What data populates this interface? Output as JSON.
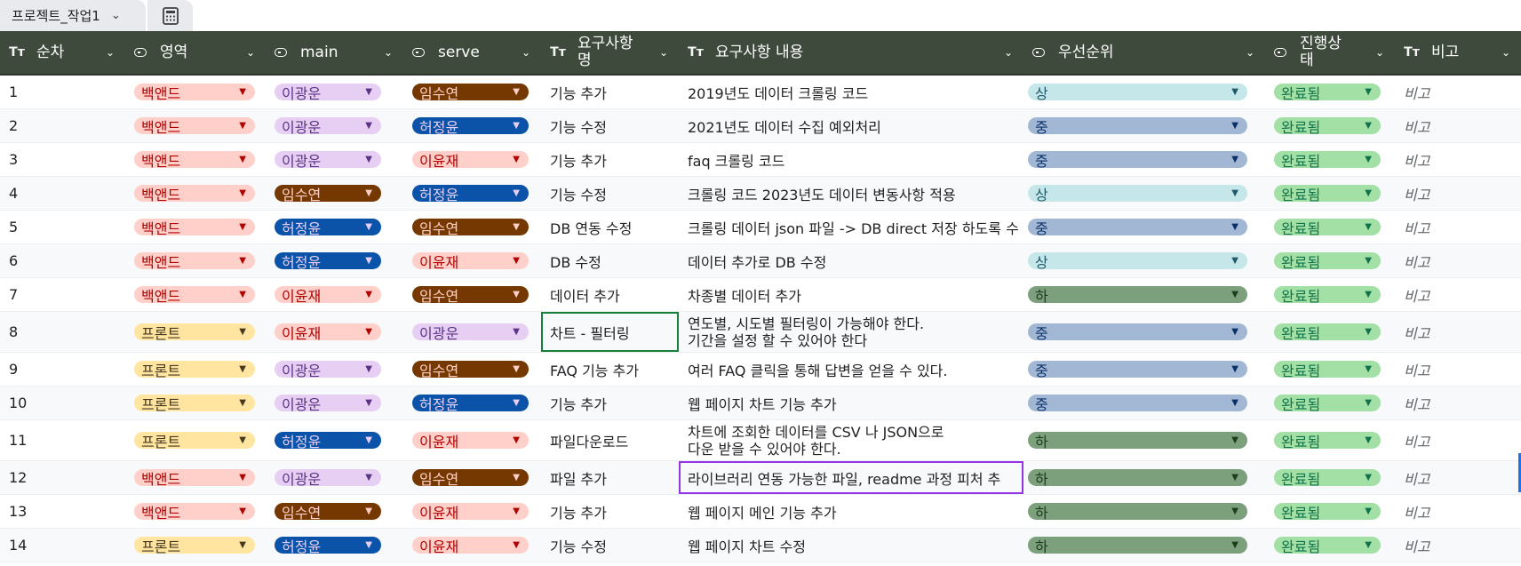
{
  "table_name": "프로젝트_작업1",
  "headers": [
    "순차",
    "영역",
    "main",
    "serve",
    "요구사항 명",
    "요구사항 내용",
    "우선순위",
    "진행상태",
    "비고"
  ],
  "rows": [
    {
      "num": "1",
      "area": "백앤드",
      "main": "이광운",
      "serve": "임수연",
      "name": "기능 추가",
      "desc": "2019년도 데이터 크롤링 코드",
      "priority": "상",
      "status": "완료됨",
      "note": "비고"
    },
    {
      "num": "2",
      "area": "백앤드",
      "main": "이광운",
      "serve": "허정윤",
      "name": "기능 수정",
      "desc": "2021년도 데이터 수집 예외처리",
      "priority": "중",
      "status": "완료됨",
      "note": "비고"
    },
    {
      "num": "3",
      "area": "백앤드",
      "main": "이광운",
      "serve": "이윤재",
      "name": "기능 추가",
      "desc": "faq 크롤링 코드",
      "priority": "중",
      "status": "완료됨",
      "note": "비고"
    },
    {
      "num": "4",
      "area": "백앤드",
      "main": "임수연",
      "serve": "허정윤",
      "name": "기능 수정",
      "desc": "크롤링 코드 2023년도 데이터 변동사항 적용",
      "priority": "상",
      "status": "완료됨",
      "note": "비고"
    },
    {
      "num": "5",
      "area": "백앤드",
      "main": "허정윤",
      "serve": "임수연",
      "name": "DB 연동 수정",
      "desc": "크롤링 데이터 json 파일 -> DB direct 저장 하도록 수",
      "priority": "중",
      "status": "완료됨",
      "note": "비고"
    },
    {
      "num": "6",
      "area": "백앤드",
      "main": "허정윤",
      "serve": "이윤재",
      "name": "DB 수정",
      "desc": "데이터 추가로 DB 수정",
      "priority": "상",
      "status": "완료됨",
      "note": "비고"
    },
    {
      "num": "7",
      "area": "백앤드",
      "main": "이윤재",
      "serve": "임수연",
      "name": "데이터 추가",
      "desc": "차종별 데이터 추가",
      "priority": "하",
      "status": "완료됨",
      "note": "비고"
    },
    {
      "num": "8",
      "area": "프론트",
      "main": "이윤재",
      "serve": "이광운",
      "name": "차트 - 필터링",
      "desc": "연도별, 시도별 필터링이 가능해야 한다.\n기간을 설정 할 수 있어야 한다",
      "priority": "중",
      "status": "완료됨",
      "note": "비고"
    },
    {
      "num": "9",
      "area": "프론트",
      "main": "이광운",
      "serve": "임수연",
      "name": "FAQ 기능 추가",
      "desc": "여러 FAQ 클릭을 통해 답변을 얻을 수 있다.",
      "priority": "중",
      "status": "완료됨",
      "note": "비고"
    },
    {
      "num": "10",
      "area": "프론트",
      "main": "이광운",
      "serve": "허정윤",
      "name": "기능 추가",
      "desc": "웹 페이지 차트 기능 추가",
      "priority": "중",
      "status": "완료됨",
      "note": "비고"
    },
    {
      "num": "11",
      "area": "프론트",
      "main": "허정윤",
      "serve": "이윤재",
      "name": "파일다운로드",
      "desc": "차트에 조회한 데이터를 CSV 나 JSON으로\n다운 받을 수 있어야 한다.",
      "priority": "하",
      "status": "완료됨",
      "note": "비고"
    },
    {
      "num": "12",
      "area": "백앤드",
      "main": "이광운",
      "serve": "임수연",
      "name": "파일 추가",
      "desc": "라이브러리 연동 가능한 파일, readme 과정 피처 추",
      "priority": "하",
      "status": "완료됨",
      "note": "비고"
    },
    {
      "num": "13",
      "area": "백앤드",
      "main": "임수연",
      "serve": "이윤재",
      "name": "기능 추가",
      "desc": "웹 페이지 메인 기능 추가",
      "priority": "하",
      "status": "완료됨",
      "note": "비고"
    },
    {
      "num": "14",
      "area": "프론트",
      "main": "허정윤",
      "serve": "이윤재",
      "name": "기능 수정",
      "desc": "웹 페이지 차트 수정",
      "priority": "하",
      "status": "완료됨",
      "note": "비고"
    }
  ],
  "colors": {
    "header_bg": "#3e4b3c",
    "selection_green": "#188038",
    "selection_purple": "#9334e6"
  }
}
